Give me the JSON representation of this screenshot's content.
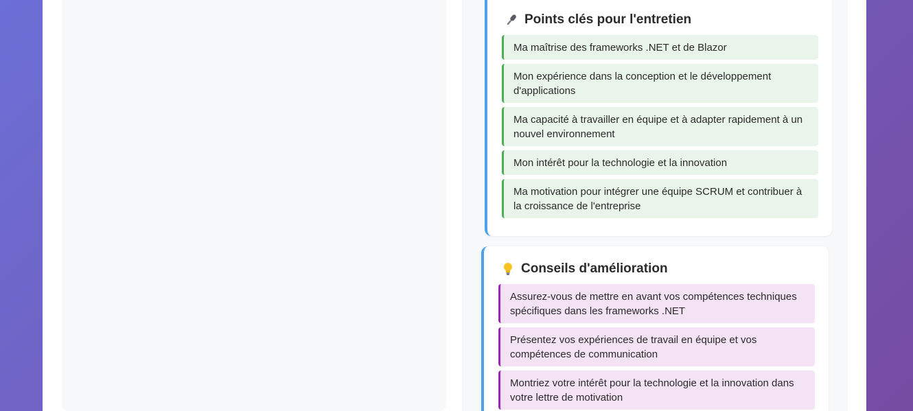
{
  "interview_card": {
    "title": "Points clés pour l'entretien",
    "icon": "microphone-icon",
    "accent_color": "#4aa3ec",
    "item_color": "#4caf50",
    "items": [
      "Ma maîtrise des frameworks .NET et de Blazor",
      "Mon expérience dans la conception et le développement d'applications",
      "Ma capacité à travailler en équipe et à adapter rapidement à un nouvel environnement",
      "Mon intérêt pour la technologie et la innovation",
      "Ma motivation pour intégrer une équipe SCRUM et contribuer à la croissance de l'entreprise"
    ]
  },
  "advice_card": {
    "title": "Conseils d'amélioration",
    "icon": "lightbulb-icon",
    "accent_color": "#4aa3ec",
    "item_color": "#9c27b0",
    "items": [
      "Assurez-vous de mettre en avant vos compétences techniques spécifiques dans les frameworks .NET",
      "Présentez vos expériences de travail en équipe et vos compétences de communication",
      "Montriez votre intérêt pour la technologie et la innovation dans votre lettre de motivation"
    ]
  }
}
